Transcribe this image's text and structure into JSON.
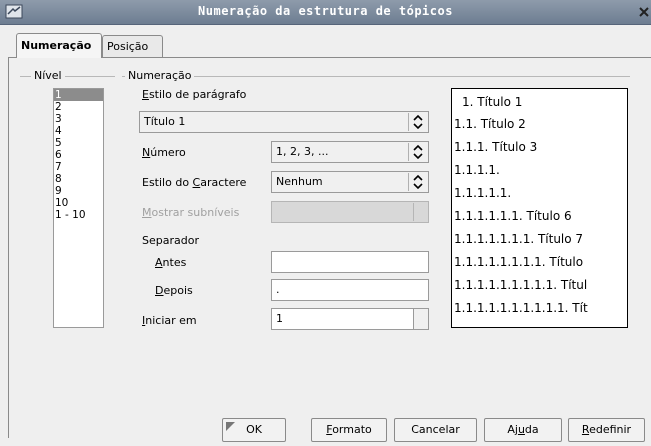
{
  "window": {
    "title": "Numeração da estrutura de tópicos"
  },
  "tabs": [
    {
      "label": "Numeração",
      "active": true
    },
    {
      "label": "Posição",
      "active": false
    }
  ],
  "level_group": {
    "label": "Nível",
    "items": [
      "1",
      "2",
      "3",
      "4",
      "5",
      "6",
      "7",
      "8",
      "9",
      "10",
      "1 - 10"
    ],
    "selected": "1"
  },
  "numbering_group": {
    "label": "Numeração",
    "paragraph_style_label": "Estilo de parágrafo",
    "paragraph_style_value": "Título 1",
    "number_label": "Número",
    "number_value": "1, 2, 3, ...",
    "char_style_label": "Estilo do Caractere",
    "char_style_value": "Nenhum",
    "show_sublevels_label": "Mostrar subníveis",
    "separator_label": "Separador",
    "before_label": "Antes",
    "before_value": "",
    "after_label": "Depois",
    "after_value": ".",
    "start_at_label": "Iniciar em",
    "start_at_value": "1"
  },
  "preview": [
    "1.  Título 1",
    "1.1.  Título 2",
    "1.1.1.  Título 3",
    "1.1.1.1.",
    "1.1.1.1.1.",
    "1.1.1.1.1.1.  Título 6",
    "1.1.1.1.1.1.1.  Título 7",
    "1.1.1.1.1.1.1.1.  Título",
    "1.1.1.1.1.1.1.1.1.  Títul",
    "1.1.1.1.1.1.1.1.1.1.  Tít"
  ],
  "buttons": {
    "ok": "OK",
    "format": "Formato",
    "cancel": "Cancelar",
    "help": "Ajuda",
    "reset": "Redefinir"
  },
  "colors": {
    "titlebar": "#7b889b",
    "selection": "#8c8c8c"
  }
}
